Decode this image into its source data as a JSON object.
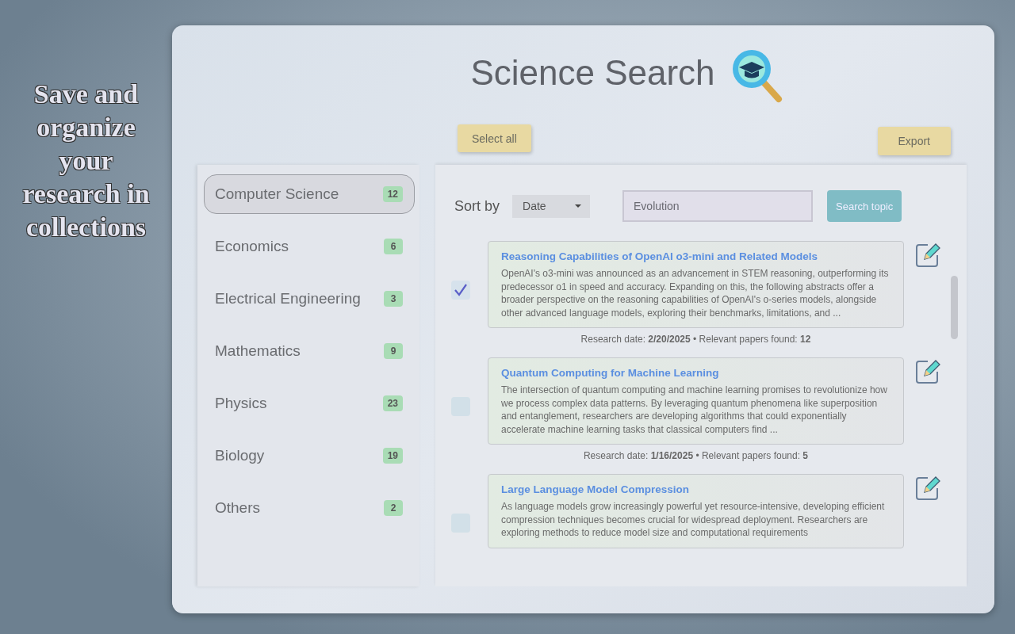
{
  "tagline": "Save and organize your research in collections",
  "app": {
    "title": "Science Search"
  },
  "toolbar": {
    "select_all": "Select all",
    "export": "Export"
  },
  "sidebar": {
    "items": [
      {
        "label": "Computer Science",
        "count": "12",
        "selected": true
      },
      {
        "label": "Economics",
        "count": "6",
        "selected": false
      },
      {
        "label": "Electrical Engineering",
        "count": "3",
        "selected": false
      },
      {
        "label": "Mathematics",
        "count": "9",
        "selected": false
      },
      {
        "label": "Physics",
        "count": "23",
        "selected": false
      },
      {
        "label": "Biology",
        "count": "19",
        "selected": false
      },
      {
        "label": "Others",
        "count": "2",
        "selected": false
      }
    ]
  },
  "controls": {
    "sort_label": "Sort by",
    "sort_value": "Date",
    "search_value": "Evolution",
    "search_button": "Search topic"
  },
  "results": [
    {
      "title": "Reasoning Capabilities of OpenAI o3-mini and Related Models",
      "abstract": "OpenAI's o3-mini was announced as an advancement in STEM reasoning, outperforming its predecessor o1 in speed and accuracy. Expanding on this, the following abstracts offer a broader perspective on the reasoning capabilities of OpenAI's o-series models, alongside other advanced language models, exploring their benchmarks, limitations, and ...",
      "meta": "Research date: **2/20/2025**  •  Relevant papers found: **12**",
      "checked": true
    },
    {
      "title": "Quantum Computing for Machine Learning",
      "abstract": "The intersection of quantum computing and machine learning promises to revolutionize how we process complex data patterns. By leveraging quantum phenomena like superposition and entanglement, researchers are developing algorithms that could exponentially accelerate machine learning tasks that classical computers find ...",
      "meta": "Research date: **1/16/2025**  •  Relevant papers found: **5**",
      "checked": false
    },
    {
      "title": "Large Language Model Compression",
      "abstract": "As language models grow increasingly powerful yet resource-intensive, developing efficient compression techniques becomes crucial for widespread deployment. Researchers are exploring methods to reduce model size and computational requirements",
      "checked": false
    }
  ]
}
